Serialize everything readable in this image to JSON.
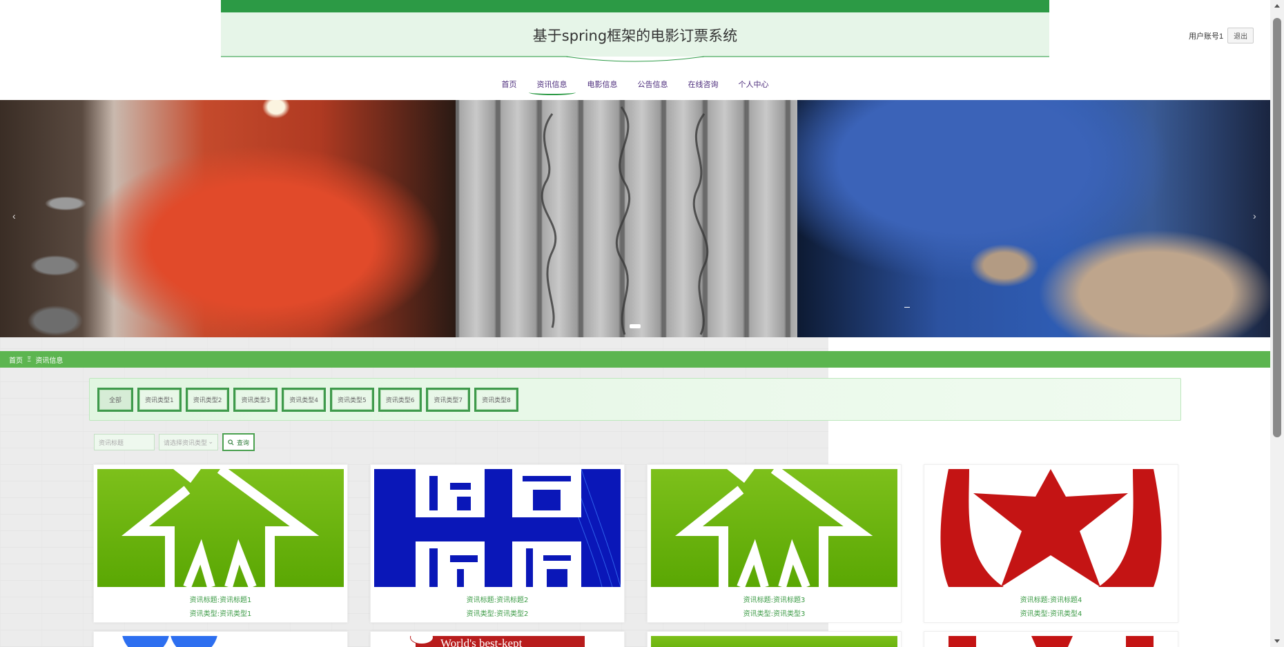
{
  "header": {
    "site_title": "基于spring框架的电影订票系统",
    "user_label": "用户账号1",
    "logout_label": "退出"
  },
  "nav": {
    "items": [
      {
        "label": "首页",
        "active": false
      },
      {
        "label": "资讯信息",
        "active": true
      },
      {
        "label": "电影信息",
        "active": false
      },
      {
        "label": "公告信息",
        "active": false
      },
      {
        "label": "在线咨询",
        "active": false
      },
      {
        "label": "个人中心",
        "active": false
      }
    ]
  },
  "banner": {
    "prev_glyph": "‹",
    "next_glyph": "›"
  },
  "breadcrumb": {
    "home": "首页",
    "separator": "Ξ",
    "current": "资讯信息"
  },
  "filter": {
    "types": [
      "全部",
      "资讯类型1",
      "资讯类型2",
      "资讯类型3",
      "资讯类型4",
      "资讯类型5",
      "资讯类型6",
      "资讯类型7",
      "资讯类型8"
    ]
  },
  "search": {
    "title_placeholder": "资讯标题",
    "type_placeholder": "请选择资讯类型",
    "button_label": "查询"
  },
  "cards": [
    {
      "title": "资讯标题:资讯标题1",
      "type": "资讯类型:资讯类型1",
      "image": "green-house-logo"
    },
    {
      "title": "资讯标题:资讯标题2",
      "type": "资讯类型:资讯类型2",
      "image": "epidemic-control-poster"
    },
    {
      "title": "资讯标题:资讯标题3",
      "type": "资讯类型:资讯类型3",
      "image": "green-house-logo"
    },
    {
      "title": "资讯标题:资讯标题4",
      "type": "资讯类型:资讯类型4",
      "image": "red-star-emblem"
    }
  ],
  "second_row_partial": {
    "paper_text": "World's best-kept"
  },
  "colors": {
    "accent_green": "#2c9a45",
    "crumb_green": "#5cb550",
    "nav_text": "#4a2a7a",
    "card_text": "#3a9a44"
  }
}
